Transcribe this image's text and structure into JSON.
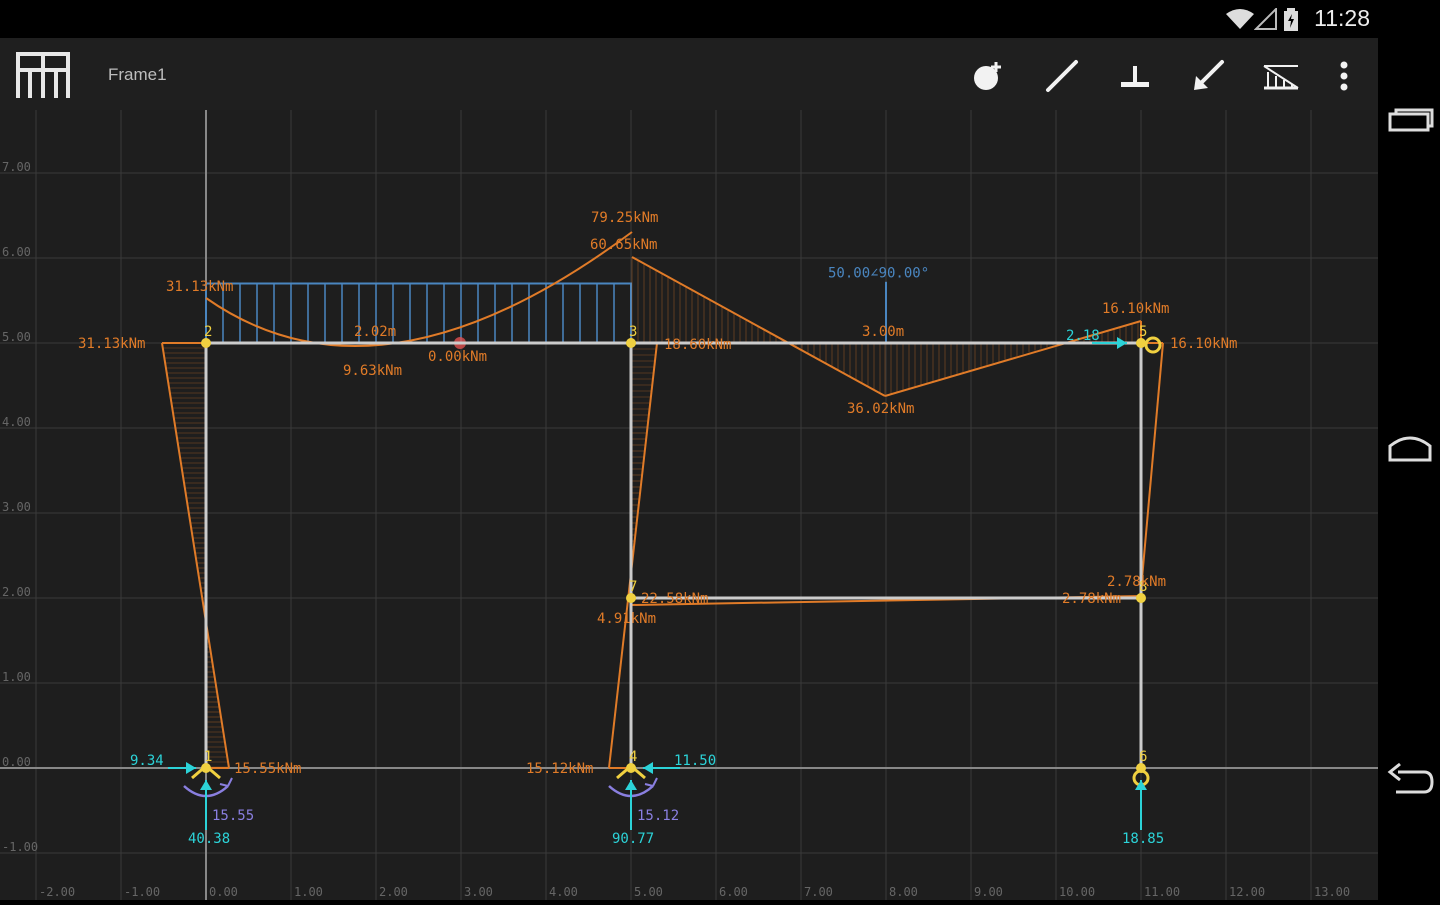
{
  "status_bar": {
    "time": "11:28"
  },
  "app": {
    "title": "Frame1",
    "toolbar": [
      {
        "name": "add-node-button",
        "icon": "add-node-icon"
      },
      {
        "name": "add-member-button",
        "icon": "draw-member-icon"
      },
      {
        "name": "add-support-button",
        "icon": "support-icon"
      },
      {
        "name": "add-load-button",
        "icon": "load-arrow-icon"
      },
      {
        "name": "distributed-load-button",
        "icon": "distributed-load-icon"
      },
      {
        "name": "overflow-menu-button",
        "icon": "more-vert-icon"
      }
    ]
  },
  "nav": [
    "recent-apps-icon",
    "home-icon",
    "back-icon"
  ],
  "colors": {
    "background": "#1e1e1e",
    "grid": "#3a3a3a",
    "member": "#cccccc",
    "moment": "#e07b28",
    "node": "#f0d040",
    "reaction": "#2cd3d8",
    "load": "#4a86c0",
    "moment_reaction": "#8a7fe0"
  },
  "axes": {
    "x_ticks": [
      "-2.00",
      "-1.00",
      "0.00",
      "1.00",
      "2.00",
      "3.00",
      "4.00",
      "5.00",
      "6.00",
      "7.00",
      "8.00",
      "9.00",
      "10.00",
      "11.00",
      "12.00",
      "13.00"
    ],
    "y_ticks": [
      "7.00",
      "6.00",
      "5.00",
      "4.00",
      "3.00",
      "2.00",
      "1.00",
      "0.00",
      "-1.00"
    ]
  },
  "nodes": [
    {
      "id": "1",
      "x": 0,
      "y": 0
    },
    {
      "id": "2",
      "x": 0,
      "y": 5
    },
    {
      "id": "3",
      "x": 5,
      "y": 5
    },
    {
      "id": "4",
      "x": 5,
      "y": 0
    },
    {
      "id": "5",
      "x": 11,
      "y": 5
    },
    {
      "id": "6",
      "x": 11,
      "y": 0
    },
    {
      "id": "7",
      "x": 5,
      "y": 2
    },
    {
      "id": "8",
      "x": 11,
      "y": 2
    }
  ],
  "distributed_load": {
    "x_from": 0,
    "x_to": 5,
    "magnitude_y": 0.7
  },
  "point_load": {
    "label": "50.00∠90.00°",
    "x": 8
  },
  "labels": {
    "dim_2_02": "2.02m",
    "dim_3_00": "3.00m",
    "m_31_13_left": "31.13kNm",
    "m_31_13_top": "31.13kNm",
    "m_9_63": "9.63kNm",
    "m_0_00": "0.00kNm",
    "m_79_25": "79.25kNm",
    "m_60_65": "60.65kNm",
    "m_18_60": "18.60kNm",
    "m_36_02": "36.02kNm",
    "m_16_10_top": "16.10kNm",
    "m_16_10_right": "16.10kNm",
    "m_2_18": "2.18",
    "m_22_58": "22.58kNm",
    "m_4_91": "4.91kNm",
    "m_2_78_top": "2.78kNm",
    "m_2_78_left": "2.78kNm",
    "m_15_55": "15.55kNm",
    "m_15_12": "15.12kNm",
    "r_9_34": "9.34",
    "r_15_55": "15.55",
    "r_40_38": "40.38",
    "r_11_50": "11.50",
    "r_15_12": "15.12",
    "r_90_77": "90.77",
    "r_18_85": "18.85"
  }
}
